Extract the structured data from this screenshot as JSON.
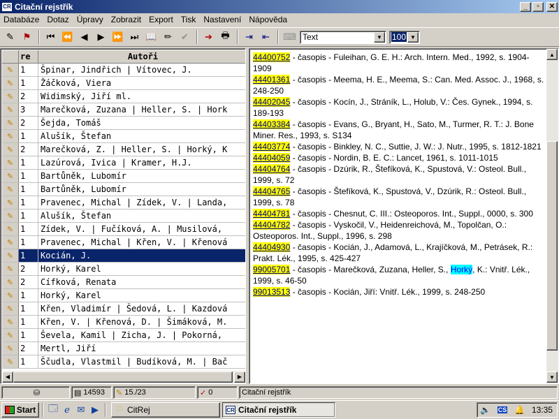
{
  "window": {
    "title": "Citační rejstřík",
    "app_icon": "CR"
  },
  "menu": [
    "Databáze",
    "Dotaz",
    "Úpravy",
    "Zobrazit",
    "Export",
    "Tisk",
    "Nastavení",
    "Nápověda"
  ],
  "toolbar": {
    "font_value": "Text",
    "size_value": "100"
  },
  "grid": {
    "headers": {
      "re": "re",
      "authors": "Autoři"
    },
    "selected_index": 15,
    "rows": [
      {
        "re": "1",
        "authors": "Špinar, Jindřich | Vítovec, J."
      },
      {
        "re": "1",
        "authors": "Žáčková, Viera"
      },
      {
        "re": "2",
        "authors": "Widimský, Jiří ml."
      },
      {
        "re": "3",
        "authors": "Marečková, Zuzana | Heller, S. | Hork"
      },
      {
        "re": "2",
        "authors": "Šejda, Tomáš"
      },
      {
        "re": "1",
        "authors": "Alušík, Štefan"
      },
      {
        "re": "2",
        "authors": "Marečková, Z. | Heller, S. | Horký, K"
      },
      {
        "re": "1",
        "authors": "Lazúrová, Ivica | Kramer, H.J."
      },
      {
        "re": "1",
        "authors": "Bartůněk, Lubomír"
      },
      {
        "re": "1",
        "authors": "Bartůněk, Lubomír"
      },
      {
        "re": "1",
        "authors": "Pravenec, Michal | Zídek, V. | Landa,"
      },
      {
        "re": "1",
        "authors": "Alušík, Štefan"
      },
      {
        "re": "1",
        "authors": "Zídek, V. | Fučíková, A. | Musilová,"
      },
      {
        "re": "1",
        "authors": "Pravenec, Michal | Křen, V. | Křenová"
      },
      {
        "re": "1",
        "authors": "Kocián, J."
      },
      {
        "re": "2",
        "authors": "Horký, Karel"
      },
      {
        "re": "2",
        "authors": "Cífková, Renata"
      },
      {
        "re": "1",
        "authors": "Horký, Karel"
      },
      {
        "re": "1",
        "authors": "Křen, Vladimír | Šedová, L. | Kazdová"
      },
      {
        "re": "1",
        "authors": "Křen, V. | Křenová, D. | Šimáková, M."
      },
      {
        "re": "1",
        "authors": "Ševela, Kamil | Zicha, J. | Pokorná,"
      },
      {
        "re": "2",
        "authors": "Mertl, Jiří"
      },
      {
        "re": "1",
        "authors": "Ščudla, Vlastmil | Budíková, M. | Bač"
      }
    ]
  },
  "entries": [
    {
      "id": "44400752",
      "text": " - časopis - Fuleihan, G. E. H.: Arch. Intern. Med., 1992, s. 1904-1909"
    },
    {
      "id": "44401361",
      "text": " - časopis - Meema, H. E., Meema, S.: Can. Med. Assoc. J., 1968, s. 248-250"
    },
    {
      "id": "44402045",
      "text": " - časopis - Kocín, J., Stráník, L., Holub, V.: Čes. Gynek., 1994, s. 189-193"
    },
    {
      "id": "44403384",
      "text": " - časopis - Evans, G., Bryant, H., Sato, M., Turmer, R. T.: J. Bone Miner. Res., 1993, s. S134"
    },
    {
      "id": "44403774",
      "text": " - časopis - Binkley, N. C., Suttie, J. W.: J. Nutr., 1995, s. 1812-1821"
    },
    {
      "id": "44404059",
      "text": " - časopis - Nordin, B. E. C.: Lancet, 1961, s. 1011-1015"
    },
    {
      "id": "44404764",
      "text": " - časopis - Dzúrik, R., Štefíková, K., Spustová, V.: Osteol. Bull., 1999, s. 72"
    },
    {
      "id": "44404765",
      "text": " - časopis - Štefíková, K., Spustová, V., Dzúrik, R.: Osteol. Bull., 1999, s. 78"
    },
    {
      "id": "44404781",
      "text": " - časopis - Chesnut, C. III.: Osteoporos. Int., Suppl., 0000, s. 300"
    },
    {
      "id": "44404782",
      "text": " - časopis - Vyskočil, V., Heidenreichová, M., Topolčan, O.: Osteoporos. Int., Suppl., 1996, s. 298"
    },
    {
      "id": "44404930",
      "text": " - časopis - Kocián, J., Adamová, L., Krajíčková, M., Petrásek, R.: Prakt. Lék., 1995, s. 425-427"
    },
    {
      "id": "99005701",
      "text": " - časopis - Marečková, Zuzana, Heller, S., ",
      "highlight": "Horký",
      "text_after": ", K.: Vnitř. Lék., 1999, s. 46-50"
    },
    {
      "id": "99013513",
      "text": " - časopis - Kocián, Jiří: Vnitř. Lék., 1999, s. 248-250"
    }
  ],
  "status": {
    "count": "14593",
    "position": "15./23",
    "errors": "0",
    "label": "Citační rejstřík"
  },
  "taskbar": {
    "start": "Start",
    "tasks": [
      "CitRej",
      "Citační rejstřík"
    ],
    "clock": "13:35",
    "lang": "CS"
  }
}
